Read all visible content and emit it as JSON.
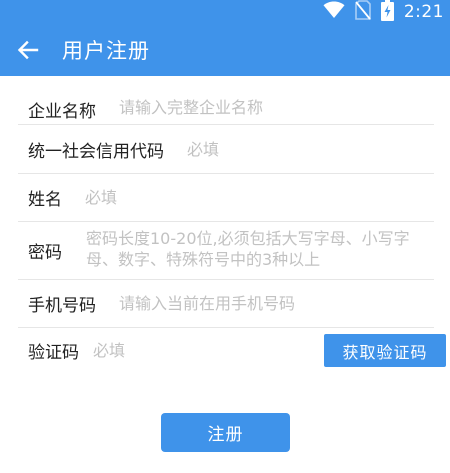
{
  "status_bar": {
    "time": "2:21",
    "icons": [
      "wifi-icon",
      "no-sim-icon",
      "battery-charging-icon"
    ]
  },
  "toolbar": {
    "back_icon": "arrow-left-icon",
    "title": "用户注册"
  },
  "form": {
    "company": {
      "label": "企业名称",
      "placeholder": "请输入完整企业名称"
    },
    "credit_code": {
      "label": "统一社会信用代码",
      "placeholder": "必填"
    },
    "name": {
      "label": "姓名",
      "placeholder": "必填"
    },
    "password": {
      "label": "密码",
      "placeholder": "密码长度10-20位,必须包括大写字母、小写字母、数字、特殊符号中的3种以上"
    },
    "phone": {
      "label": "手机号码",
      "placeholder": "请输入当前在用手机号码"
    },
    "verify_code": {
      "label": "验证码",
      "placeholder": "必填",
      "button_label": "获取验证码"
    }
  },
  "submit_label": "注册",
  "colors": {
    "primary": "#3f93ea",
    "placeholder": "#c2c2c2",
    "divider": "#e6e6e6",
    "text": "#222222"
  }
}
